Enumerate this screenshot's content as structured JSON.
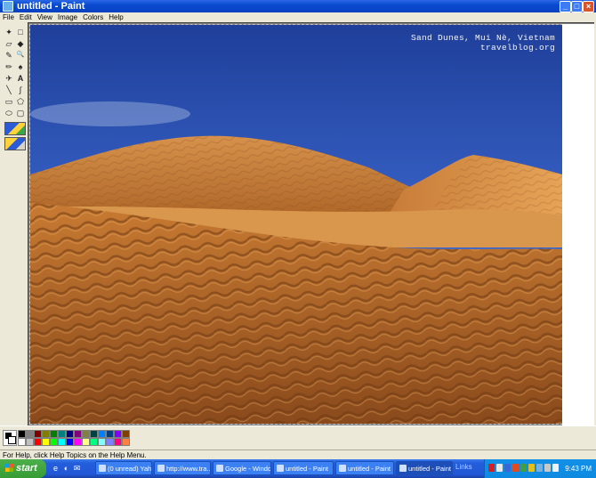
{
  "window": {
    "title": "untitled - Paint",
    "min_glyph": "_",
    "max_glyph": "□",
    "close_glyph": "×"
  },
  "menu": [
    "File",
    "Edit",
    "View",
    "Image",
    "Colors",
    "Help"
  ],
  "tools": [
    {
      "name": "free-select-icon",
      "glyph": "✦"
    },
    {
      "name": "rect-select-icon",
      "glyph": "□"
    },
    {
      "name": "eraser-icon",
      "glyph": "▱"
    },
    {
      "name": "fill-icon",
      "glyph": "◆"
    },
    {
      "name": "color-picker-icon",
      "glyph": "✎"
    },
    {
      "name": "magnifier-icon",
      "glyph": "🔍"
    },
    {
      "name": "pencil-icon",
      "glyph": "✏"
    },
    {
      "name": "brush-icon",
      "glyph": "♠"
    },
    {
      "name": "airbrush-icon",
      "glyph": "✈"
    },
    {
      "name": "text-icon",
      "glyph": "A"
    },
    {
      "name": "line-icon",
      "glyph": "╲"
    },
    {
      "name": "curve-icon",
      "glyph": "∫"
    },
    {
      "name": "rectangle-icon",
      "glyph": "▭"
    },
    {
      "name": "polygon-icon",
      "glyph": "⬠"
    },
    {
      "name": "ellipse-icon",
      "glyph": "⬭"
    },
    {
      "name": "rounded-rect-icon",
      "glyph": "▢"
    }
  ],
  "canvas": {
    "caption_line1": "Sand Dunes, Mui Nè, Vietnam",
    "caption_line2": "travelblog.org"
  },
  "palette": {
    "top": [
      "#000000",
      "#808080",
      "#800000",
      "#808000",
      "#008000",
      "#008080",
      "#000080",
      "#800080",
      "#808040",
      "#004040",
      "#0080ff",
      "#004080",
      "#8000ff",
      "#804000"
    ],
    "bottom": [
      "#ffffff",
      "#c0c0c0",
      "#ff0000",
      "#ffff00",
      "#00ff00",
      "#00ffff",
      "#0000ff",
      "#ff00ff",
      "#ffff80",
      "#00ff80",
      "#80ffff",
      "#8080ff",
      "#ff0080",
      "#ff8040"
    ]
  },
  "status": "For Help, click Help Topics on the Help Menu.",
  "taskbar": {
    "start_label": "start",
    "quicklaunch": [
      "e",
      "◐",
      "✉"
    ],
    "tasks": [
      {
        "label": "(0 unread) Yah...",
        "active": false
      },
      {
        "label": "http://www.tra...",
        "active": false
      },
      {
        "label": "Google - Windo...",
        "active": false
      },
      {
        "label": "untitled - Paint",
        "active": false
      },
      {
        "label": "untitled - Paint",
        "active": false
      },
      {
        "label": "untitled - Paint",
        "active": true
      }
    ],
    "links_label": "Links",
    "clock": "9:43 PM"
  }
}
